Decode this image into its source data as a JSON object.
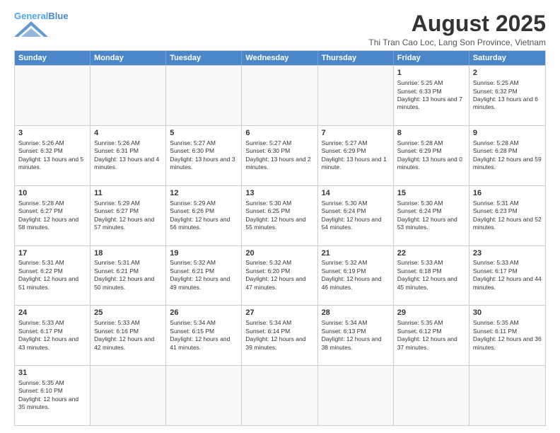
{
  "header": {
    "logo_line1": "General",
    "logo_line2": "Blue",
    "month_title": "August 2025",
    "subtitle": "Thi Tran Cao Loc, Lang Son Province, Vietnam"
  },
  "weekdays": [
    "Sunday",
    "Monday",
    "Tuesday",
    "Wednesday",
    "Thursday",
    "Friday",
    "Saturday"
  ],
  "weeks": [
    [
      {
        "day": "",
        "info": ""
      },
      {
        "day": "",
        "info": ""
      },
      {
        "day": "",
        "info": ""
      },
      {
        "day": "",
        "info": ""
      },
      {
        "day": "",
        "info": ""
      },
      {
        "day": "1",
        "info": "Sunrise: 5:25 AM\nSunset: 6:33 PM\nDaylight: 13 hours and 7 minutes."
      },
      {
        "day": "2",
        "info": "Sunrise: 5:25 AM\nSunset: 6:32 PM\nDaylight: 13 hours and 6 minutes."
      }
    ],
    [
      {
        "day": "3",
        "info": "Sunrise: 5:26 AM\nSunset: 6:32 PM\nDaylight: 13 hours and 5 minutes."
      },
      {
        "day": "4",
        "info": "Sunrise: 5:26 AM\nSunset: 6:31 PM\nDaylight: 13 hours and 4 minutes."
      },
      {
        "day": "5",
        "info": "Sunrise: 5:27 AM\nSunset: 6:30 PM\nDaylight: 13 hours and 3 minutes."
      },
      {
        "day": "6",
        "info": "Sunrise: 5:27 AM\nSunset: 6:30 PM\nDaylight: 13 hours and 2 minutes."
      },
      {
        "day": "7",
        "info": "Sunrise: 5:27 AM\nSunset: 6:29 PM\nDaylight: 13 hours and 1 minute."
      },
      {
        "day": "8",
        "info": "Sunrise: 5:28 AM\nSunset: 6:29 PM\nDaylight: 13 hours and 0 minutes."
      },
      {
        "day": "9",
        "info": "Sunrise: 5:28 AM\nSunset: 6:28 PM\nDaylight: 12 hours and 59 minutes."
      }
    ],
    [
      {
        "day": "10",
        "info": "Sunrise: 5:28 AM\nSunset: 6:27 PM\nDaylight: 12 hours and 58 minutes."
      },
      {
        "day": "11",
        "info": "Sunrise: 5:29 AM\nSunset: 6:27 PM\nDaylight: 12 hours and 57 minutes."
      },
      {
        "day": "12",
        "info": "Sunrise: 5:29 AM\nSunset: 6:26 PM\nDaylight: 12 hours and 56 minutes."
      },
      {
        "day": "13",
        "info": "Sunrise: 5:30 AM\nSunset: 6:25 PM\nDaylight: 12 hours and 55 minutes."
      },
      {
        "day": "14",
        "info": "Sunrise: 5:30 AM\nSunset: 6:24 PM\nDaylight: 12 hours and 54 minutes."
      },
      {
        "day": "15",
        "info": "Sunrise: 5:30 AM\nSunset: 6:24 PM\nDaylight: 12 hours and 53 minutes."
      },
      {
        "day": "16",
        "info": "Sunrise: 5:31 AM\nSunset: 6:23 PM\nDaylight: 12 hours and 52 minutes."
      }
    ],
    [
      {
        "day": "17",
        "info": "Sunrise: 5:31 AM\nSunset: 6:22 PM\nDaylight: 12 hours and 51 minutes."
      },
      {
        "day": "18",
        "info": "Sunrise: 5:31 AM\nSunset: 6:21 PM\nDaylight: 12 hours and 50 minutes."
      },
      {
        "day": "19",
        "info": "Sunrise: 5:32 AM\nSunset: 6:21 PM\nDaylight: 12 hours and 49 minutes."
      },
      {
        "day": "20",
        "info": "Sunrise: 5:32 AM\nSunset: 6:20 PM\nDaylight: 12 hours and 47 minutes."
      },
      {
        "day": "21",
        "info": "Sunrise: 5:32 AM\nSunset: 6:19 PM\nDaylight: 12 hours and 46 minutes."
      },
      {
        "day": "22",
        "info": "Sunrise: 5:33 AM\nSunset: 6:18 PM\nDaylight: 12 hours and 45 minutes."
      },
      {
        "day": "23",
        "info": "Sunrise: 5:33 AM\nSunset: 6:17 PM\nDaylight: 12 hours and 44 minutes."
      }
    ],
    [
      {
        "day": "24",
        "info": "Sunrise: 5:33 AM\nSunset: 6:17 PM\nDaylight: 12 hours and 43 minutes."
      },
      {
        "day": "25",
        "info": "Sunrise: 5:33 AM\nSunset: 6:16 PM\nDaylight: 12 hours and 42 minutes."
      },
      {
        "day": "26",
        "info": "Sunrise: 5:34 AM\nSunset: 6:15 PM\nDaylight: 12 hours and 41 minutes."
      },
      {
        "day": "27",
        "info": "Sunrise: 5:34 AM\nSunset: 6:14 PM\nDaylight: 12 hours and 39 minutes."
      },
      {
        "day": "28",
        "info": "Sunrise: 5:34 AM\nSunset: 6:13 PM\nDaylight: 12 hours and 38 minutes."
      },
      {
        "day": "29",
        "info": "Sunrise: 5:35 AM\nSunset: 6:12 PM\nDaylight: 12 hours and 37 minutes."
      },
      {
        "day": "30",
        "info": "Sunrise: 5:35 AM\nSunset: 6:11 PM\nDaylight: 12 hours and 36 minutes."
      }
    ],
    [
      {
        "day": "31",
        "info": "Sunrise: 5:35 AM\nSunset: 6:10 PM\nDaylight: 12 hours and 35 minutes."
      },
      {
        "day": "",
        "info": ""
      },
      {
        "day": "",
        "info": ""
      },
      {
        "day": "",
        "info": ""
      },
      {
        "day": "",
        "info": ""
      },
      {
        "day": "",
        "info": ""
      },
      {
        "day": "",
        "info": ""
      }
    ]
  ]
}
